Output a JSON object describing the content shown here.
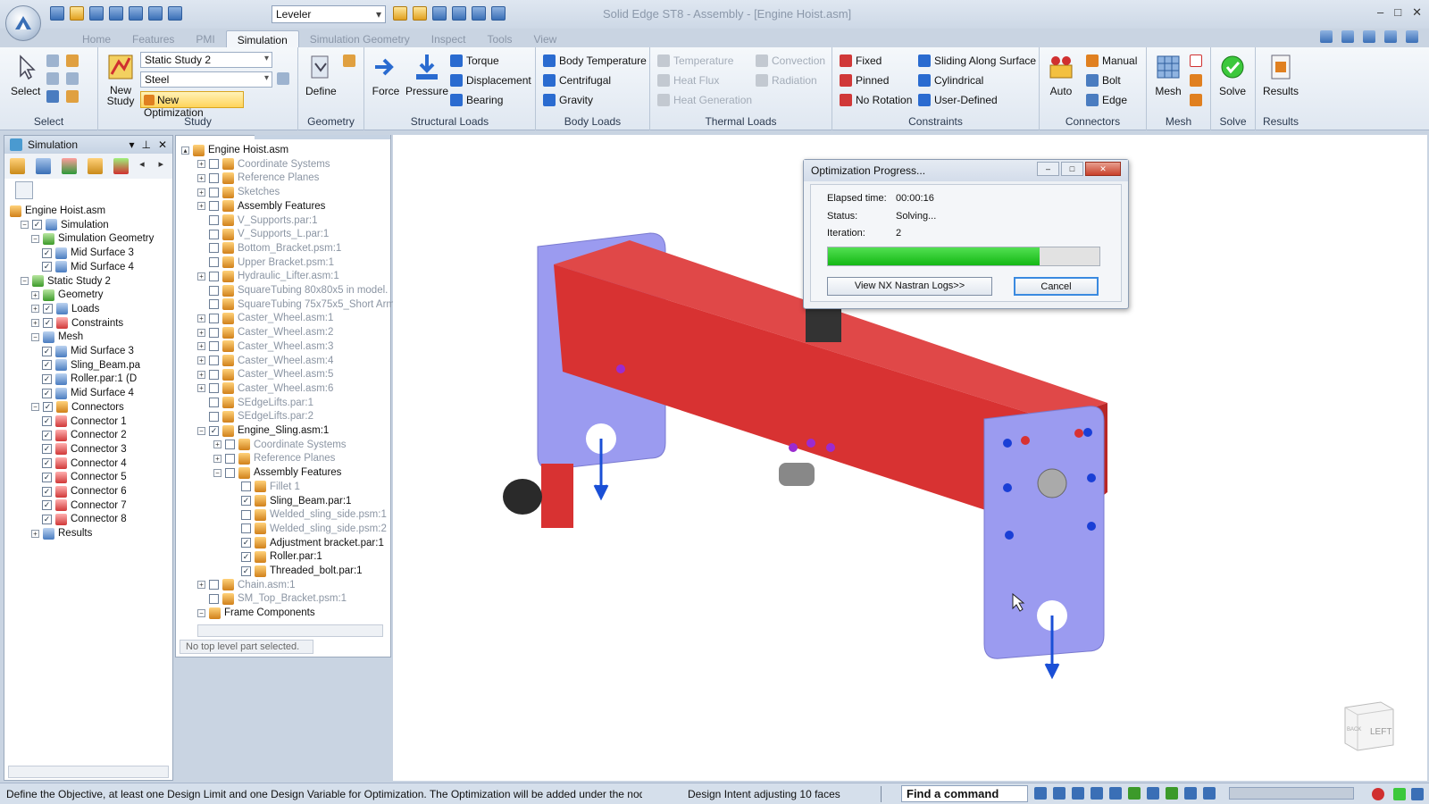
{
  "app": {
    "title": "Solid Edge ST8 - Assembly - [Engine Hoist.asm]"
  },
  "qat": {
    "combo_value": "Leveler"
  },
  "tabs": [
    "Home",
    "Features",
    "PMI",
    "Simulation",
    "Simulation Geometry",
    "Inspect",
    "Tools",
    "View"
  ],
  "ribbon": {
    "select": {
      "label": "Select",
      "group": "Select"
    },
    "study": {
      "new_study": "New Study",
      "study_value": "Static Study 2",
      "material_value": "Steel",
      "new_optimization": "New Optimization",
      "group": "Study"
    },
    "geometry": {
      "define": "Define",
      "group": "Geometry"
    },
    "structural": {
      "force": "Force",
      "pressure": "Pressure",
      "torque": "Torque",
      "displacement": "Displacement",
      "bearing": "Bearing",
      "group": "Structural Loads"
    },
    "body": {
      "body_temperature": "Body Temperature",
      "centrifugal": "Centrifugal",
      "gravity": "Gravity",
      "group": "Body Loads"
    },
    "thermal": {
      "temperature": "Temperature",
      "heat_flux": "Heat Flux",
      "heat_generation": "Heat Generation",
      "convection": "Convection",
      "radiation": "Radiation",
      "group": "Thermal Loads"
    },
    "constraints": {
      "fixed": "Fixed",
      "pinned": "Pinned",
      "no_rotation": "No Rotation",
      "sliding": "Sliding Along Surface",
      "cylindrical": "Cylindrical",
      "user_defined": "User-Defined",
      "group": "Constraints"
    },
    "connectors": {
      "auto": "Auto",
      "manual": "Manual",
      "bolt": "Bolt",
      "edge": "Edge",
      "group": "Connectors"
    },
    "mesh": {
      "label": "Mesh",
      "group": "Mesh"
    },
    "solve": {
      "label": "Solve",
      "group": "Solve"
    },
    "results": {
      "label": "Results",
      "group": "Results"
    }
  },
  "simpanel": {
    "title": "Simulation",
    "tree": [
      "Engine Hoist.asm",
      "Simulation",
      "Simulation Geometry",
      "Mid Surface 3",
      "Mid Surface 4",
      "Static Study 2",
      "Geometry",
      "Loads",
      "Constraints",
      "Mesh",
      "Mid Surface 3",
      "Sling_Beam.pa",
      "Roller.par:1 (D",
      "Mid Surface 4",
      "Connectors",
      "Connector 1",
      "Connector 2",
      "Connector 3",
      "Connector 4",
      "Connector 5",
      "Connector 6",
      "Connector 7",
      "Connector 8",
      "Results"
    ]
  },
  "pathfinder": {
    "items": [
      "Engine Hoist.asm",
      "Coordinate Systems",
      "Reference Planes",
      "Sketches",
      "Assembly Features",
      "V_Supports.par:1",
      "V_Supports_L.par:1",
      "Bottom_Bracket.psm:1",
      "Upper Bracket.psm:1",
      "Hydraulic_Lifter.asm:1",
      "SquareTubing 80x80x5 in model.",
      "SquareTubing 75x75x5_Short Arm",
      "Caster_Wheel.asm:1",
      "Caster_Wheel.asm:2",
      "Caster_Wheel.asm:3",
      "Caster_Wheel.asm:4",
      "Caster_Wheel.asm:5",
      "Caster_Wheel.asm:6",
      "SEdgeLifts.par:1",
      "SEdgeLifts.par:2",
      "Engine_Sling.asm:1",
      "Coordinate Systems",
      "Reference Planes",
      "Assembly Features",
      "Fillet 1",
      "Sling_Beam.par:1",
      "Welded_sling_side.psm:1",
      "Welded_sling_side.psm:2",
      "Adjustment bracket.par:1",
      "Roller.par:1",
      "Threaded_bolt.par:1",
      "Chain.asm:1",
      "SM_Top_Bracket.psm:1",
      "Frame Components"
    ],
    "status": "No top level part selected."
  },
  "dialog": {
    "title": "Optimization Progress...",
    "elapsed_label": "Elapsed time:",
    "elapsed_value": "00:00:16",
    "status_label": "Status:",
    "status_value": "Solving...",
    "iteration_label": "Iteration:",
    "iteration_value": "2",
    "progress": 0.78,
    "logs_button": "View NX Nastran Logs>>",
    "cancel_button": "Cancel"
  },
  "viewcube": {
    "face": "LEFT",
    "side": "BACK"
  },
  "statusbar": {
    "prompt": "Define the Objective, at least one Design Limit and one Design Variable for Optimization. The Optimization will be added under the nod",
    "intent": "Design Intent adjusting 10 faces",
    "find_command": "Find a command"
  },
  "colors": {
    "beam": "#d83232",
    "plate": "#9b9bf0",
    "progress": "#14b814",
    "load_arrow": "#1a4fd6"
  }
}
